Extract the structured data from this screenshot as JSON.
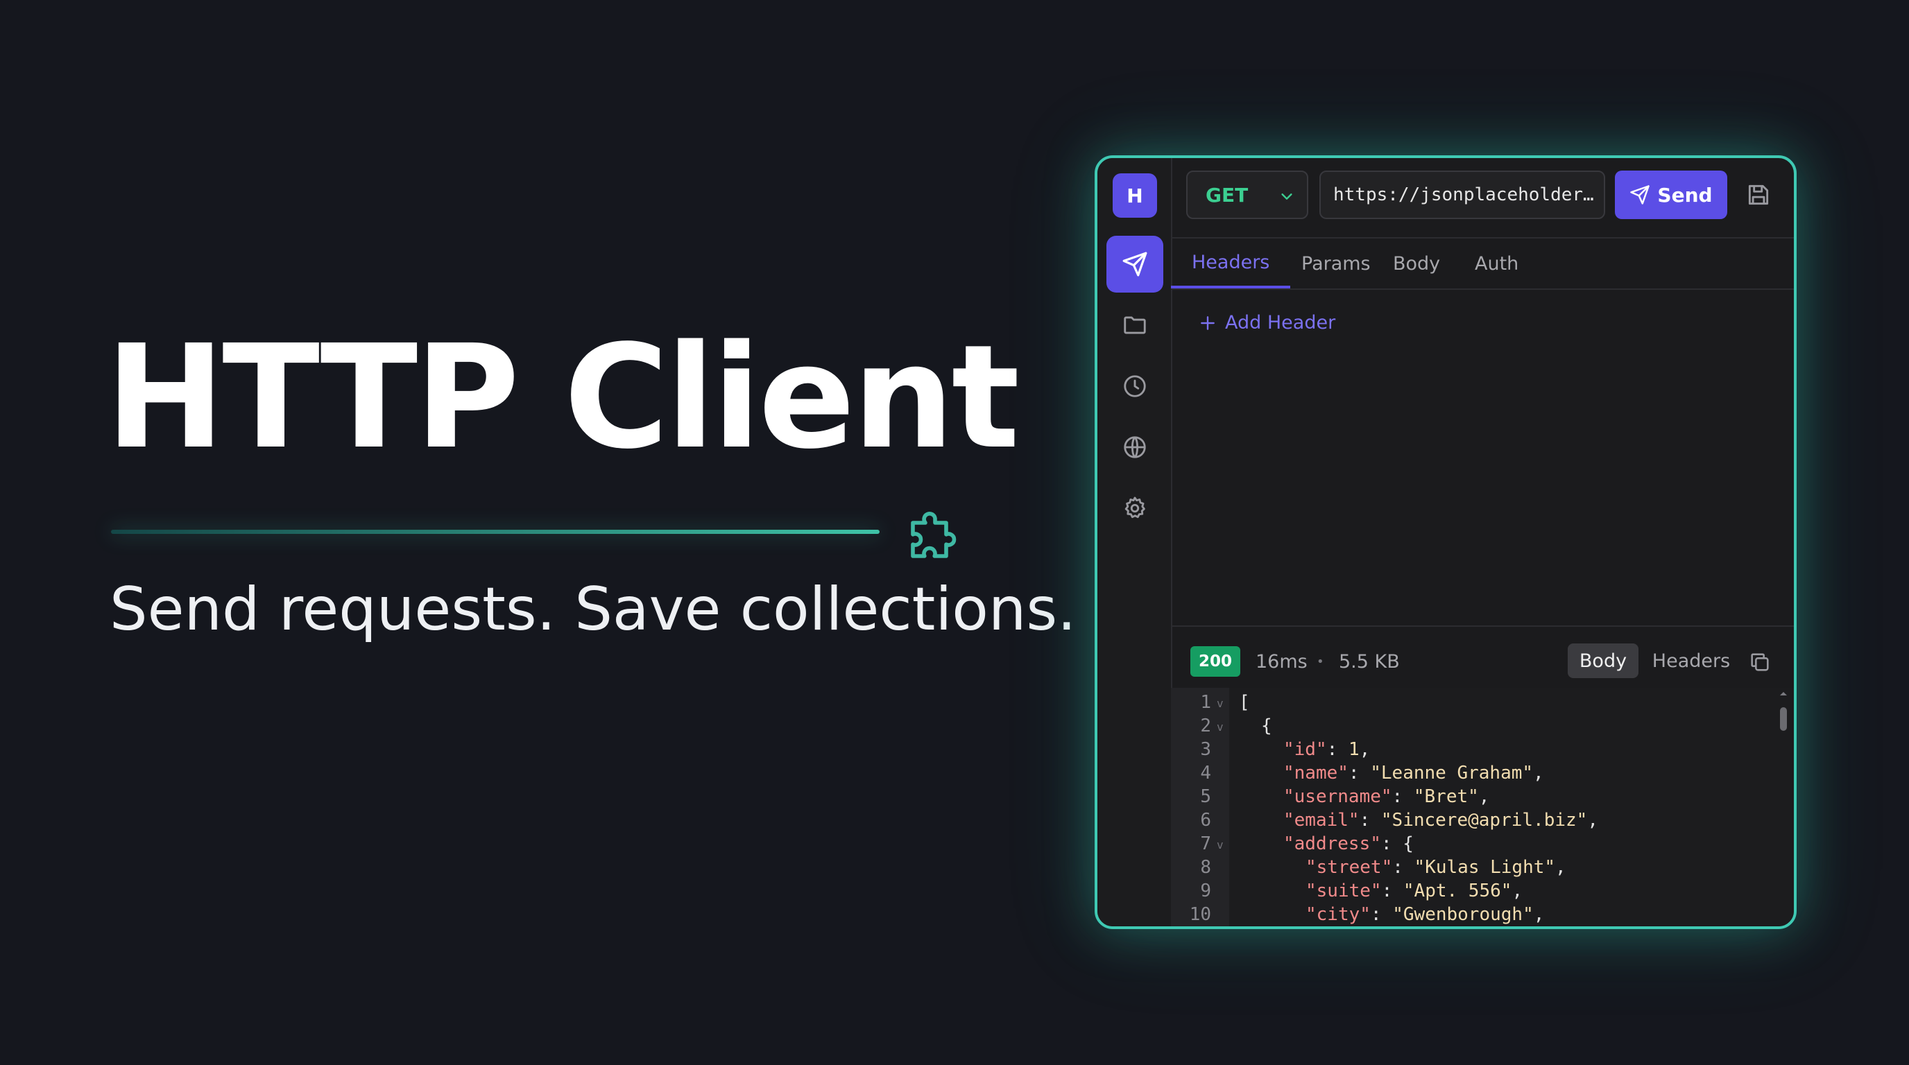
{
  "hero": {
    "title": "HTTP Client",
    "subtitle": "Send requests. Save collections.",
    "icon": "puzzle-icon"
  },
  "colors": {
    "background": "#15171e",
    "accent": "#5b4ee6",
    "glow": "#3fc9b3",
    "method_get": "#3ccf91",
    "status_ok": "#169d62",
    "json_key": "#f08a8a",
    "json_value": "#f2ddb0"
  },
  "sidebar": {
    "logo_letter": "H",
    "items": [
      {
        "icon": "send-icon",
        "active": true
      },
      {
        "icon": "folder-icon",
        "active": false
      },
      {
        "icon": "clock-icon",
        "active": false
      },
      {
        "icon": "globe-icon",
        "active": false
      },
      {
        "icon": "gear-icon",
        "active": false
      }
    ]
  },
  "request": {
    "method": "GET",
    "url": "https://jsonplaceholder…",
    "send_label": "Send"
  },
  "request_tabs": [
    "Headers",
    "Params",
    "Body",
    "Auth"
  ],
  "active_request_tab": "Headers",
  "headers_panel": {
    "add_label": "Add Header"
  },
  "response": {
    "status": "200",
    "time": "16ms",
    "separator": "•",
    "size": "5.5 KB",
    "tabs": [
      "Body",
      "Headers"
    ],
    "active_tab": "Body"
  },
  "code_lines": [
    {
      "n": "1",
      "fold": true,
      "indent": 0,
      "parts": [
        [
          "p",
          "["
        ]
      ]
    },
    {
      "n": "2",
      "fold": true,
      "indent": 1,
      "parts": [
        [
          "p",
          "{"
        ]
      ]
    },
    {
      "n": "3",
      "fold": false,
      "indent": 2,
      "parts": [
        [
          "k",
          "\"id\""
        ],
        [
          "p",
          ": "
        ],
        [
          "n",
          "1"
        ],
        [
          "p",
          ","
        ]
      ]
    },
    {
      "n": "4",
      "fold": false,
      "indent": 2,
      "parts": [
        [
          "k",
          "\"name\""
        ],
        [
          "p",
          ": "
        ],
        [
          "s",
          "\"Leanne Graham\""
        ],
        [
          "p",
          ","
        ]
      ]
    },
    {
      "n": "5",
      "fold": false,
      "indent": 2,
      "parts": [
        [
          "k",
          "\"username\""
        ],
        [
          "p",
          ": "
        ],
        [
          "s",
          "\"Bret\""
        ],
        [
          "p",
          ","
        ]
      ]
    },
    {
      "n": "6",
      "fold": false,
      "indent": 2,
      "parts": [
        [
          "k",
          "\"email\""
        ],
        [
          "p",
          ": "
        ],
        [
          "s",
          "\"Sincere@april.biz\""
        ],
        [
          "p",
          ","
        ]
      ]
    },
    {
      "n": "7",
      "fold": true,
      "indent": 2,
      "parts": [
        [
          "k",
          "\"address\""
        ],
        [
          "p",
          ": {"
        ]
      ]
    },
    {
      "n": "8",
      "fold": false,
      "indent": 3,
      "parts": [
        [
          "k",
          "\"street\""
        ],
        [
          "p",
          ": "
        ],
        [
          "s",
          "\"Kulas Light\""
        ],
        [
          "p",
          ","
        ]
      ]
    },
    {
      "n": "9",
      "fold": false,
      "indent": 3,
      "parts": [
        [
          "k",
          "\"suite\""
        ],
        [
          "p",
          ": "
        ],
        [
          "s",
          "\"Apt. 556\""
        ],
        [
          "p",
          ","
        ]
      ]
    },
    {
      "n": "10",
      "fold": false,
      "indent": 3,
      "parts": [
        [
          "k",
          "\"city\""
        ],
        [
          "p",
          ": "
        ],
        [
          "s",
          "\"Gwenborough\""
        ],
        [
          "p",
          ","
        ]
      ]
    }
  ]
}
